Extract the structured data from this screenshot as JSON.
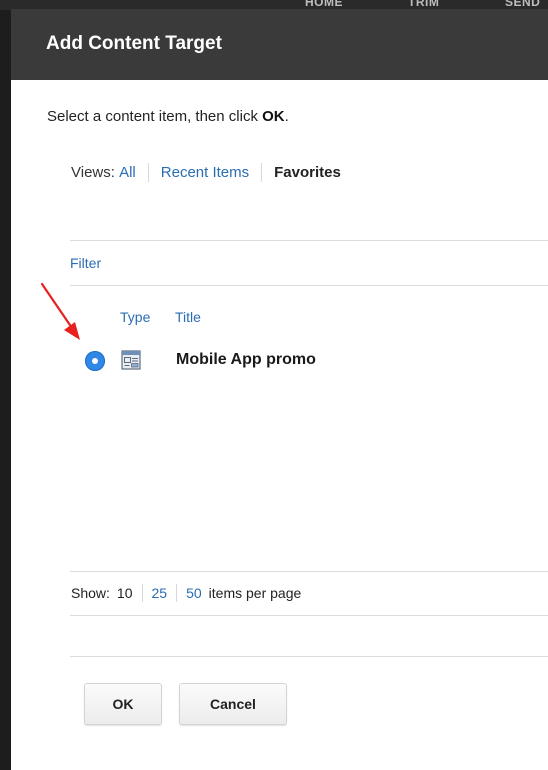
{
  "background_nav": [
    "HOME",
    "TRIM",
    "SEND"
  ],
  "dialog": {
    "title": "Add Content Target",
    "instruction_prefix": "Select a content item, then click ",
    "instruction_bold": "OK",
    "instruction_suffix": "."
  },
  "views": {
    "label": "Views:",
    "items": [
      "All",
      "Recent Items",
      "Favorites"
    ],
    "selected": "Favorites"
  },
  "filter_label": "Filter",
  "table": {
    "columns": [
      "Type",
      "Title"
    ],
    "rows": [
      {
        "title": "Mobile App promo",
        "type_icon": "content-item-icon",
        "selected": true
      }
    ]
  },
  "paging": {
    "label": "Show:",
    "options": [
      "10",
      "25",
      "50"
    ],
    "current": "10",
    "suffix": "items per page"
  },
  "buttons": {
    "ok": "OK",
    "cancel": "Cancel"
  },
  "colors": {
    "header_bg": "#3a3a3a",
    "link": "#2a6db3",
    "radio": "#2f87e6",
    "annotation_arrow": "#e8201f"
  }
}
